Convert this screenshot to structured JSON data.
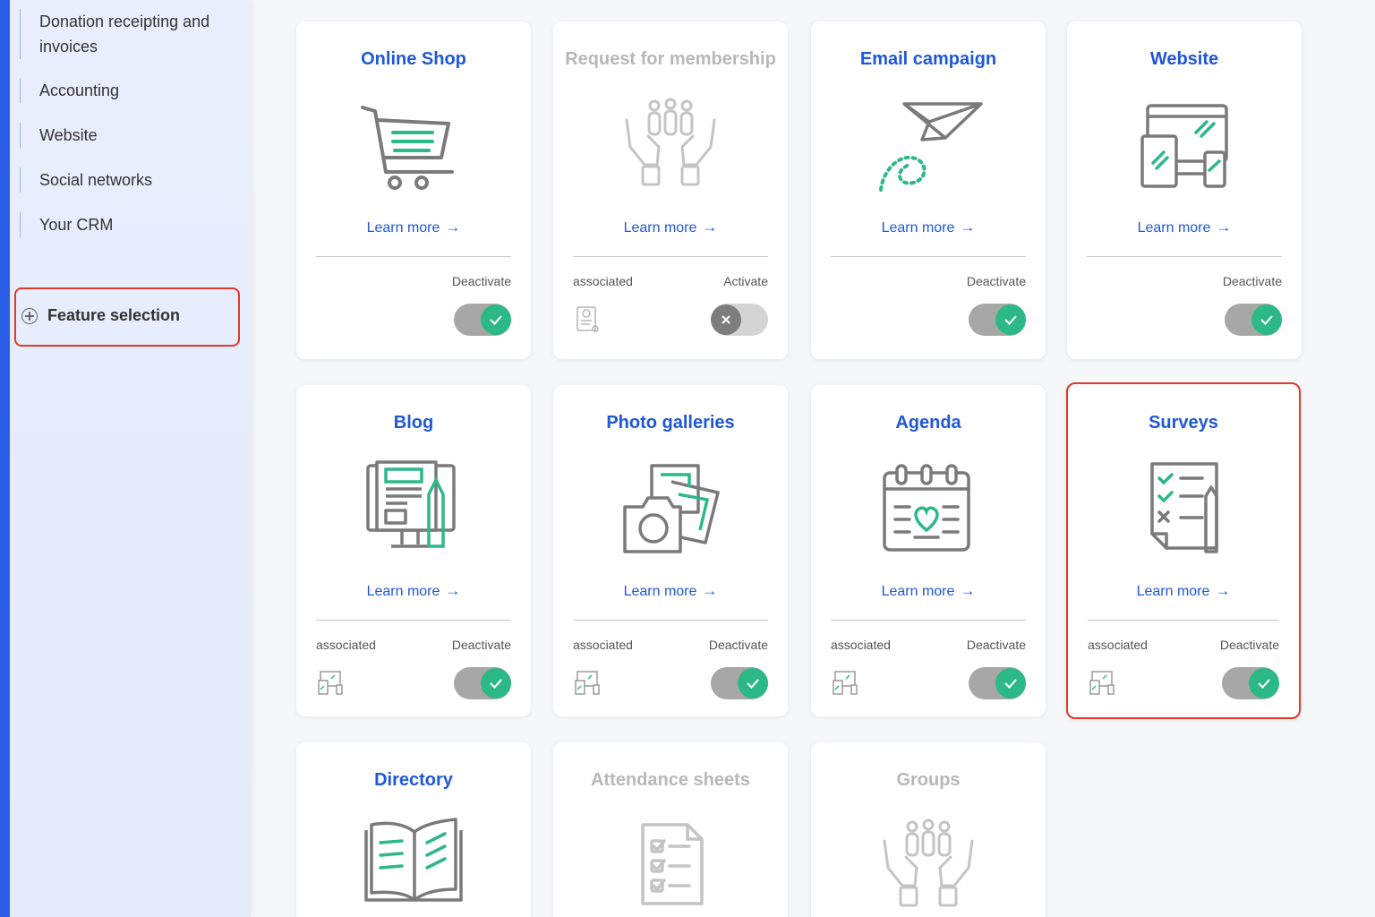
{
  "sidebar": {
    "items": [
      {
        "label": "Donation receipting and invoices"
      },
      {
        "label": "Accounting"
      },
      {
        "label": "Website"
      },
      {
        "label": "Social networks"
      },
      {
        "label": "Your CRM"
      }
    ],
    "feature_selection": {
      "label": "Feature selection",
      "icon": "plus-circle-icon"
    }
  },
  "colors": {
    "accent": "#1f57d9",
    "active": "#2db888",
    "sidebar_strip": "#2a5ee8",
    "highlight": "#e0382b"
  },
  "cards": [
    {
      "title": "Online Shop",
      "icon": "shopping-cart-icon",
      "learn_more": "Learn more",
      "associated": "",
      "state": "Deactivate",
      "enabled": true
    },
    {
      "title": "Request for membership",
      "icon": "hands-people-icon",
      "learn_more": "Learn more",
      "associated": "associated",
      "state": "Activate",
      "enabled": false
    },
    {
      "title": "Email campaign",
      "icon": "paper-plane-icon",
      "learn_more": "Learn more",
      "associated": "",
      "state": "Deactivate",
      "enabled": true
    },
    {
      "title": "Website",
      "icon": "devices-icon",
      "learn_more": "Learn more",
      "associated": "",
      "state": "Deactivate",
      "enabled": true
    },
    {
      "title": "Blog",
      "icon": "blog-monitor-icon",
      "learn_more": "Learn more",
      "associated": "associated",
      "state": "Deactivate",
      "enabled": true
    },
    {
      "title": "Photo galleries",
      "icon": "camera-photos-icon",
      "learn_more": "Learn more",
      "associated": "associated",
      "state": "Deactivate",
      "enabled": true
    },
    {
      "title": "Agenda",
      "icon": "calendar-heart-icon",
      "learn_more": "Learn more",
      "associated": "associated",
      "state": "Deactivate",
      "enabled": true
    },
    {
      "title": "Surveys",
      "icon": "survey-checklist-icon",
      "learn_more": "Learn more",
      "associated": "associated",
      "state": "Deactivate",
      "enabled": true,
      "selected": true
    },
    {
      "title": "Directory",
      "icon": "open-book-icon",
      "enabled": true
    },
    {
      "title": "Attendance sheets",
      "icon": "attendance-checklist-icon",
      "enabled": false
    },
    {
      "title": "Groups",
      "icon": "hands-people-icon",
      "enabled": false
    }
  ]
}
